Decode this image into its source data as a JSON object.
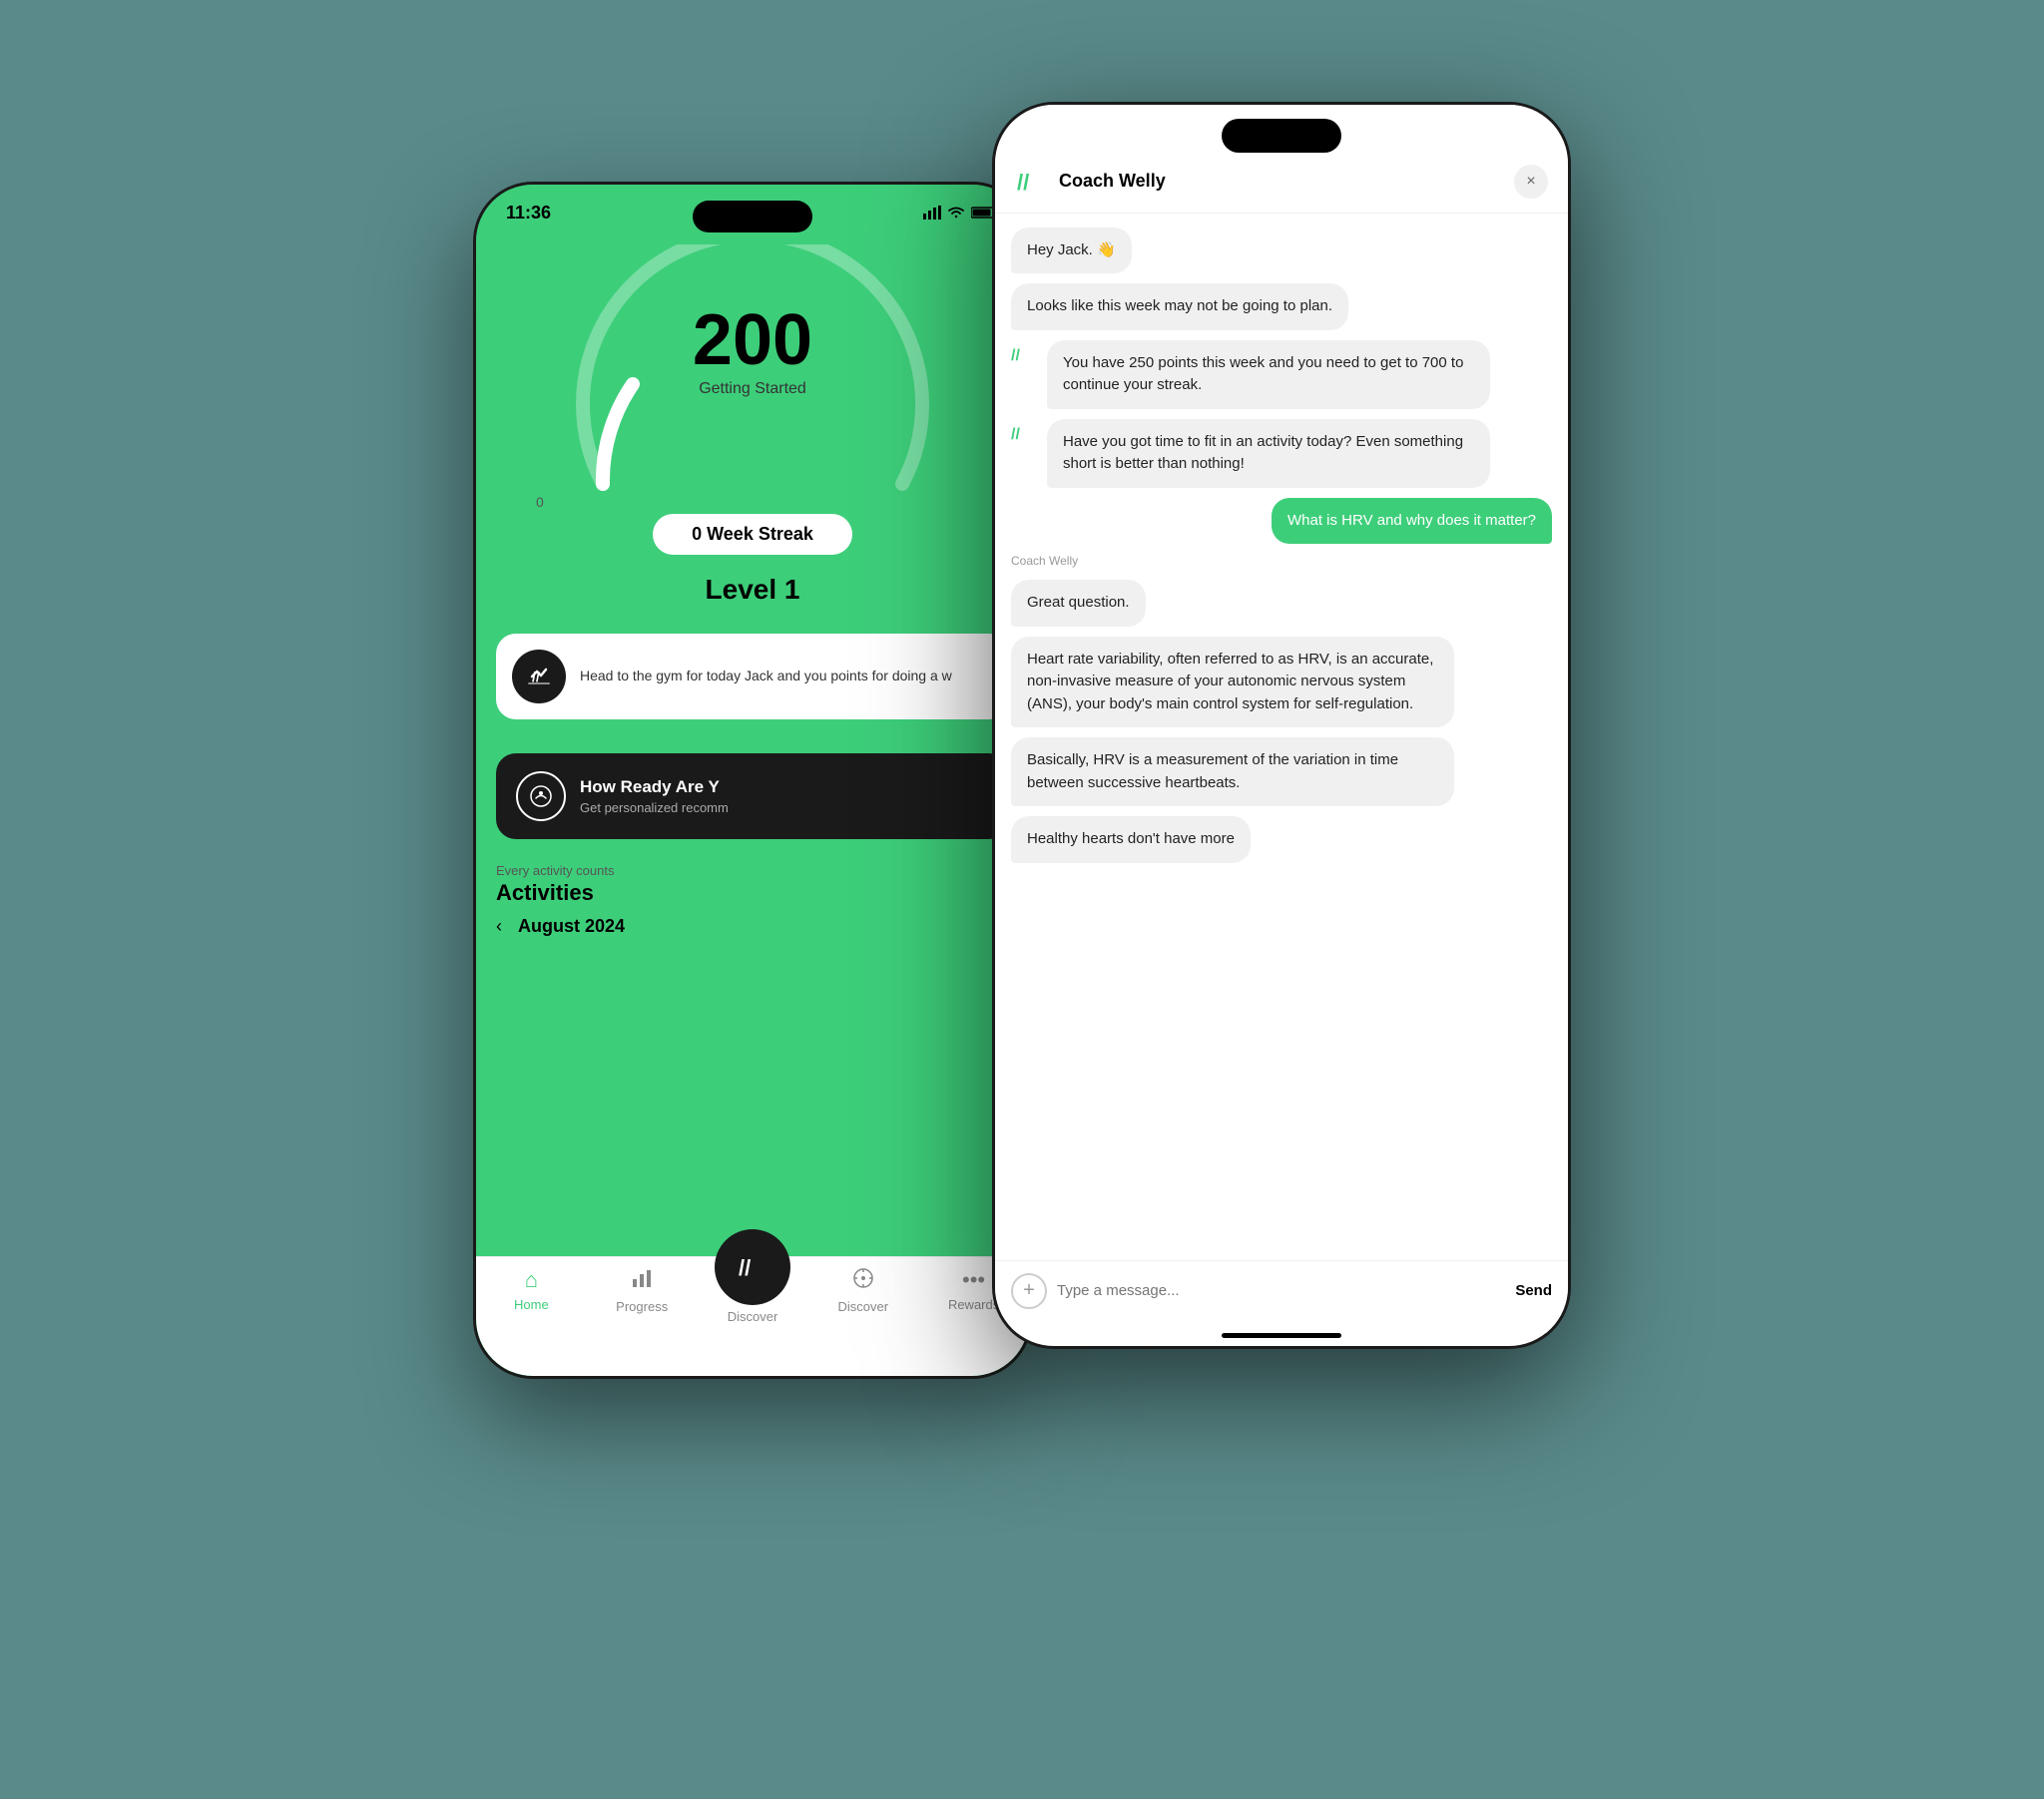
{
  "background_color": "#5a8a8a",
  "back_phone": {
    "time": "11:36",
    "score": "200",
    "score_label": "Getting Started",
    "streak": "0 Week Streak",
    "level": "Level 1",
    "zero_label": "0",
    "activity": {
      "text": "Head to the gym for today Jack and you points for doing a w"
    },
    "how_ready": {
      "title": "How Ready Are Y",
      "subtitle": "Get personalized recomm"
    },
    "activities_section": {
      "every_label": "Every activity counts",
      "title": "Activities",
      "month": "August 2024"
    },
    "nav": {
      "home": "Home",
      "progress": "Progress",
      "discover": "Discover",
      "rewards": "Rewards"
    }
  },
  "front_phone": {
    "header": {
      "coach_name": "Coach Welly",
      "close": "×"
    },
    "messages": [
      {
        "type": "received",
        "text": "Hey Jack. 👋",
        "has_icon": false
      },
      {
        "type": "received",
        "text": "Looks like this week may not be going to plan.",
        "has_icon": false
      },
      {
        "type": "received",
        "text": "You have 250 points this week and you need to get to 700 to continue your streak.",
        "has_icon": true
      },
      {
        "type": "received",
        "text": "Have you got time to fit in an activity today? Even something short is better than nothing!",
        "has_icon": true
      },
      {
        "type": "sent",
        "text": "What is HRV and why does it matter?",
        "has_icon": false
      },
      {
        "type": "coach_label",
        "text": "Coach Welly"
      },
      {
        "type": "received",
        "text": "Great question.",
        "has_icon": false
      },
      {
        "type": "received",
        "text": "Heart rate variability, often referred to as HRV, is an accurate, non-invasive measure of your autonomic nervous system (ANS), your body's main control system for self-regulation.",
        "has_icon": false
      },
      {
        "type": "received",
        "text": "Basically, HRV is a measurement of the variation in time between successive heartbeats.",
        "has_icon": false
      },
      {
        "type": "received",
        "text": "Healthy hearts don't have more",
        "has_icon": false
      }
    ],
    "input": {
      "placeholder": "Type a message...",
      "send_label": "Send"
    }
  }
}
